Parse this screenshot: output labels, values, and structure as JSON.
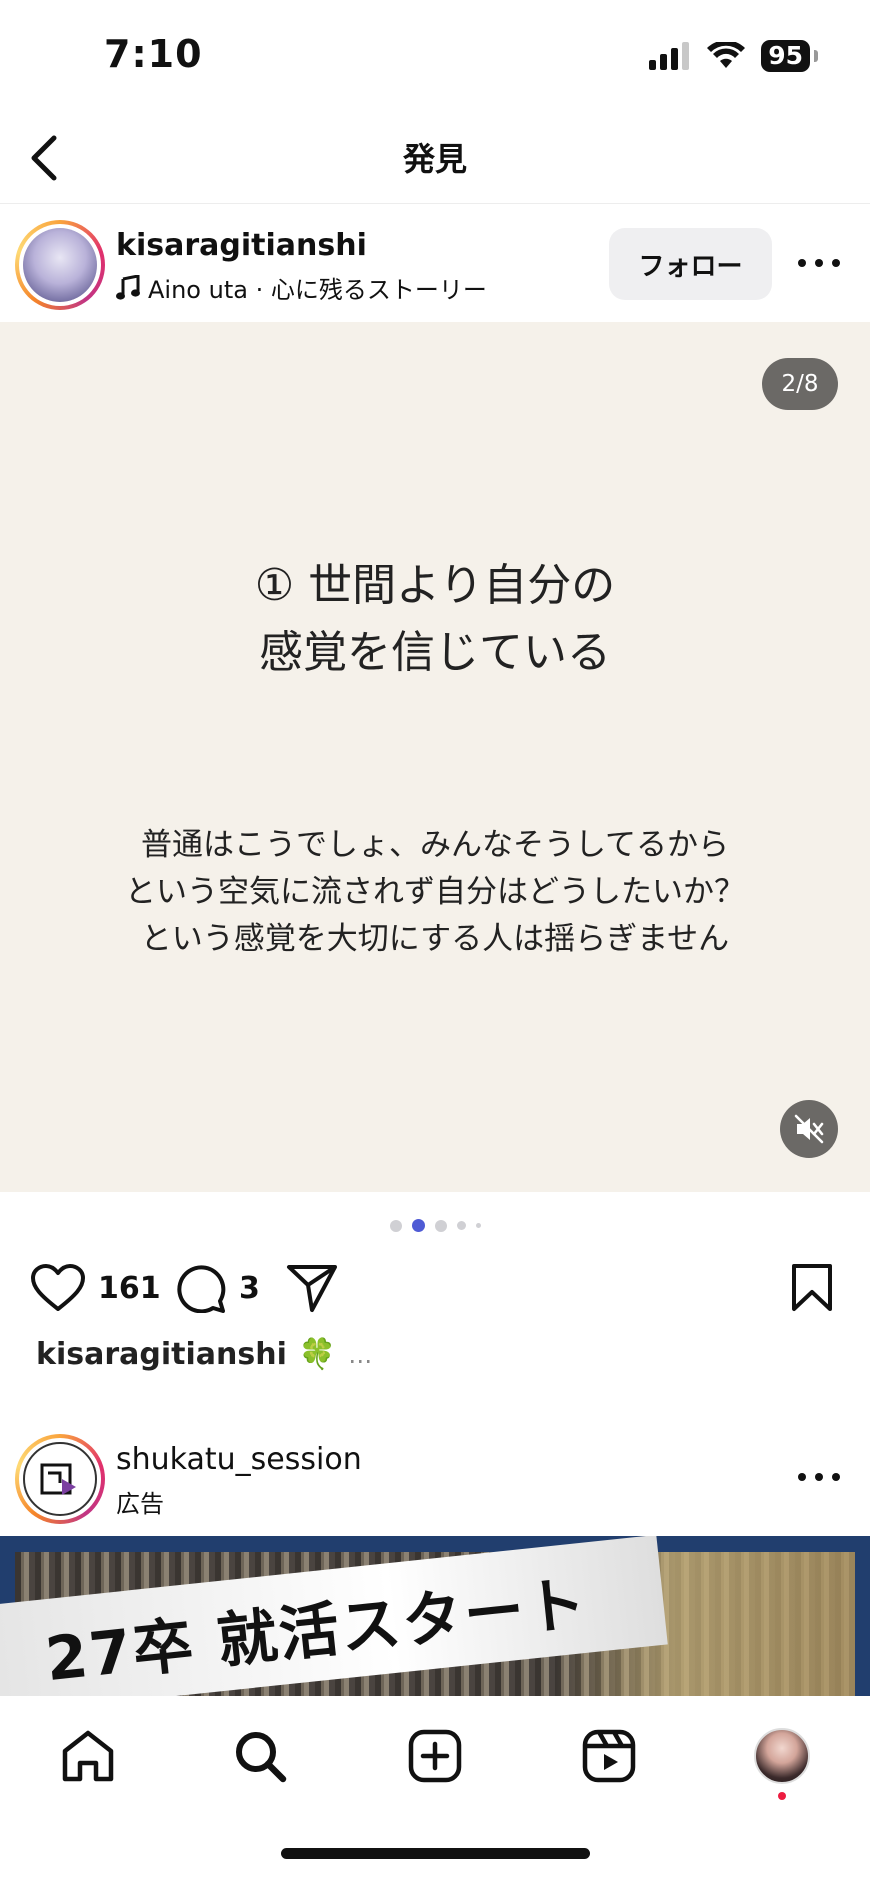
{
  "status_bar": {
    "time": "7:10",
    "battery": "95"
  },
  "nav": {
    "title": "発見"
  },
  "post": {
    "username": "kisaragitianshi",
    "music": "Aino uta · 心に残るストーリー",
    "follow_label": "フォロー",
    "slide_counter": "2/8",
    "heading_line1": "① 世間より自分の",
    "heading_line2": "感覚を信じている",
    "body_line1": "普通はこうでしょ、みんなそうしてるから",
    "body_line2": "という空気に流されず自分はどうしたいか？",
    "body_line3": "という感覚を大切にする人は揺らぎません",
    "likes": "161",
    "comments": "3",
    "caption_user": "kisaragitianshi",
    "caption_emoji": "🍀",
    "caption_more": "…"
  },
  "ad": {
    "username": "shukatu_session",
    "label": "広告",
    "banner_text": "27卒 就活スタート"
  },
  "colors": {
    "media_bg": "#f5f1ea",
    "pager_active": "#4f5bd5",
    "ad_border": "#213e6e"
  }
}
